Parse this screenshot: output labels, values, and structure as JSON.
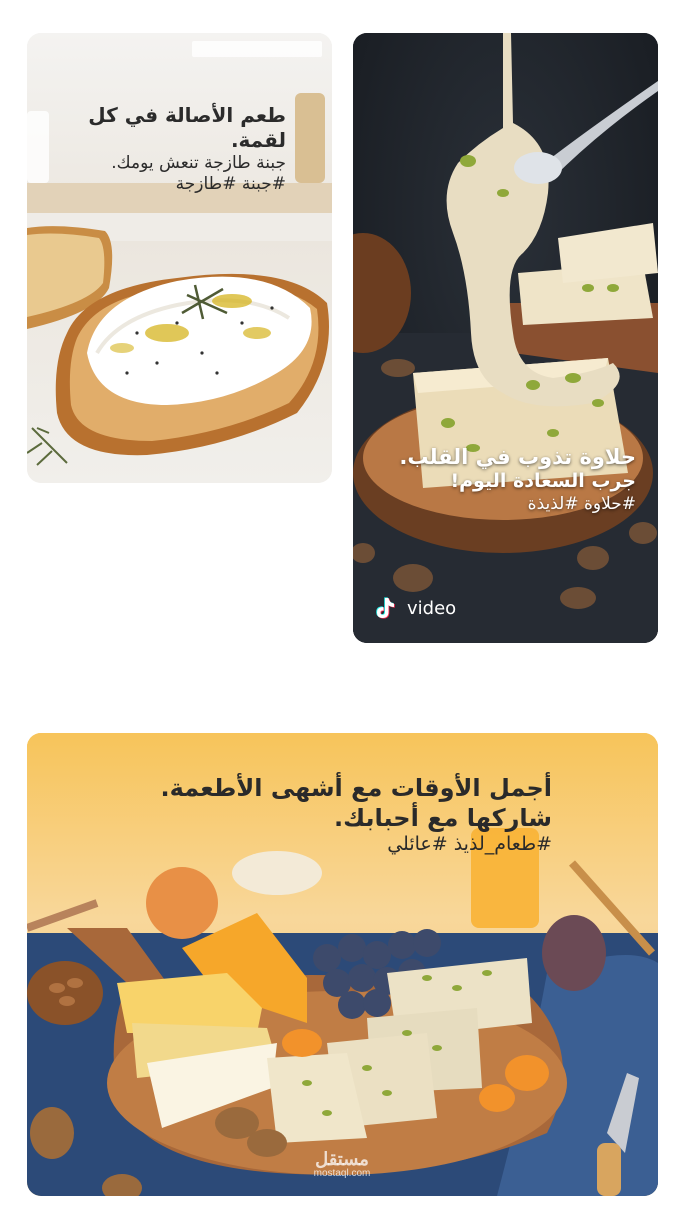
{
  "posts": [
    {
      "id": "cheese",
      "lines": [
        "طعم الأصالة في كل لقمة.",
        "جبنة طازجة تنعش يومك.",
        "#جبنة #طازجة"
      ]
    },
    {
      "id": "halva",
      "lines": [
        "حلاوة تذوب في القلب.",
        "جرب السعادة اليوم!",
        "#حلاوة #لذيذة"
      ],
      "badge_label": "video",
      "badge_icon": "tiktok-icon"
    },
    {
      "id": "board",
      "lines": [
        "أجمل الأوقات مع أشهى الأطعمة.",
        "شاركها مع أحبابك.",
        "#طعام_لذيذ #عائلي"
      ]
    }
  ],
  "watermark": {
    "arabic": "مستقل",
    "latin": "mostaql.com"
  },
  "colors": {
    "page_bg": "#ffffff",
    "board_bg": "#f5c35a",
    "halva_bg": "#1e2229"
  }
}
